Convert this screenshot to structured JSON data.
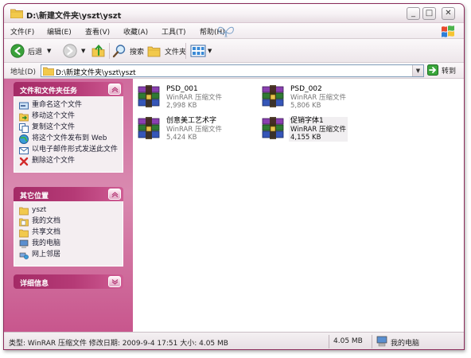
{
  "window": {
    "title": "D:\\新建文件夹\\yszt\\yszt",
    "minimize_label": "_",
    "maximize_label": "□",
    "close_label": "✕"
  },
  "menu": {
    "items": [
      "文件(F)",
      "编辑(E)",
      "查看(V)",
      "收藏(A)",
      "工具(T)",
      "帮助(H)"
    ]
  },
  "toolbar": {
    "back_label": "后退",
    "search_label": "搜索",
    "folders_label": "文件夹"
  },
  "address": {
    "label": "地址(D)",
    "value": "D:\\新建文件夹\\yszt\\yszt",
    "go_label": "转到"
  },
  "tasks": {
    "title": "文件和文件夹任务",
    "items": [
      {
        "label": "重命名这个文件",
        "icon": "rename-icon"
      },
      {
        "label": "移动这个文件",
        "icon": "move-icon"
      },
      {
        "label": "复制这个文件",
        "icon": "copy-icon"
      },
      {
        "label": "将这个文件发布到 Web",
        "icon": "web-publish-icon"
      },
      {
        "label": "以电子邮件形式发送此文件",
        "icon": "email-icon"
      },
      {
        "label": "删除这个文件",
        "icon": "delete-icon"
      }
    ]
  },
  "places": {
    "title": "其它位置",
    "items": [
      {
        "label": "yszt",
        "icon": "folder-icon"
      },
      {
        "label": "我的文档",
        "icon": "my-documents-icon"
      },
      {
        "label": "共享文档",
        "icon": "shared-documents-icon"
      },
      {
        "label": "我的电脑",
        "icon": "my-computer-icon"
      },
      {
        "label": "网上邻居",
        "icon": "network-icon"
      }
    ]
  },
  "details": {
    "title": "详细信息"
  },
  "files": [
    {
      "name": "PSD_001",
      "type": "WinRAR 压缩文件",
      "size": "2,998 KB",
      "selected": false
    },
    {
      "name": "PSD_002",
      "type": "WinRAR 压缩文件",
      "size": "5,806 KB",
      "selected": false
    },
    {
      "name": "创意美工艺术字",
      "type": "WinRAR 压缩文件",
      "size": "5,424 KB",
      "selected": false
    },
    {
      "name": "促销字体1",
      "type": "WinRAR 压缩文件",
      "size": "4,155 KB",
      "selected": true
    }
  ],
  "status": {
    "info": "类型: WinRAR 压缩文件 修改日期: 2009-9-4 17:51 大小: 4.05 MB",
    "size": "4.05 MB",
    "location": "我的电脑"
  },
  "colors": {
    "accent": "#c4518a",
    "panel_header": "#a42a66"
  }
}
